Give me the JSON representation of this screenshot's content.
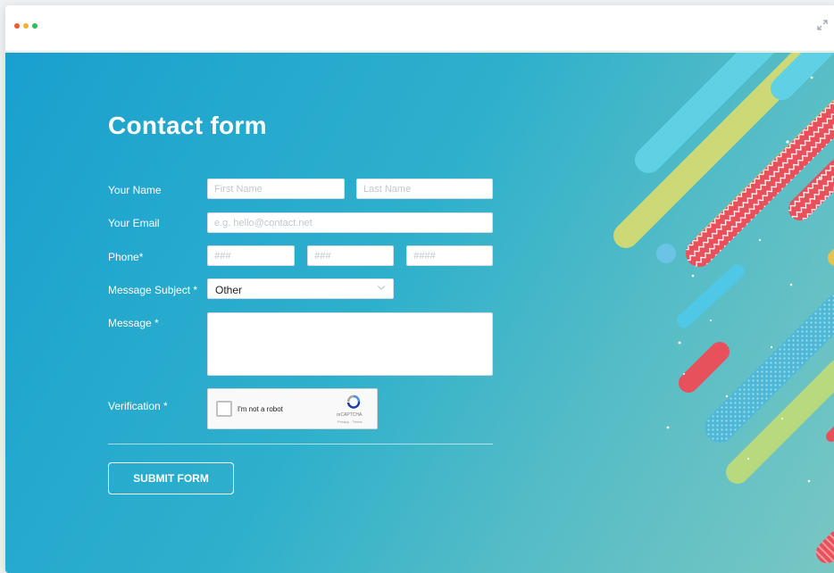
{
  "form": {
    "title": "Contact form",
    "name": {
      "label": "Your Name",
      "first_placeholder": "First Name",
      "last_placeholder": "Last Name"
    },
    "email": {
      "label": "Your Email",
      "placeholder": "e.g. hello@contact.net"
    },
    "phone": {
      "label": "Phone*",
      "part1_placeholder": "###",
      "part2_placeholder": "###",
      "part3_placeholder": "####"
    },
    "subject": {
      "label": "Message Subject *",
      "selected": "Other"
    },
    "message": {
      "label": "Message *"
    },
    "verification": {
      "label": "Verification *",
      "captcha_text": "I'm not a robot",
      "captcha_brand": "reCAPTCHA",
      "captcha_terms": "Privacy · Terms"
    },
    "submit_label": "SUBMIT FORM"
  },
  "colors": {
    "background_start": "#1aa0cf",
    "background_end": "#79c7c3",
    "accent_red": "#e8505b",
    "accent_yellow": "#e8c24e",
    "accent_cyan": "#5fd1e4"
  }
}
